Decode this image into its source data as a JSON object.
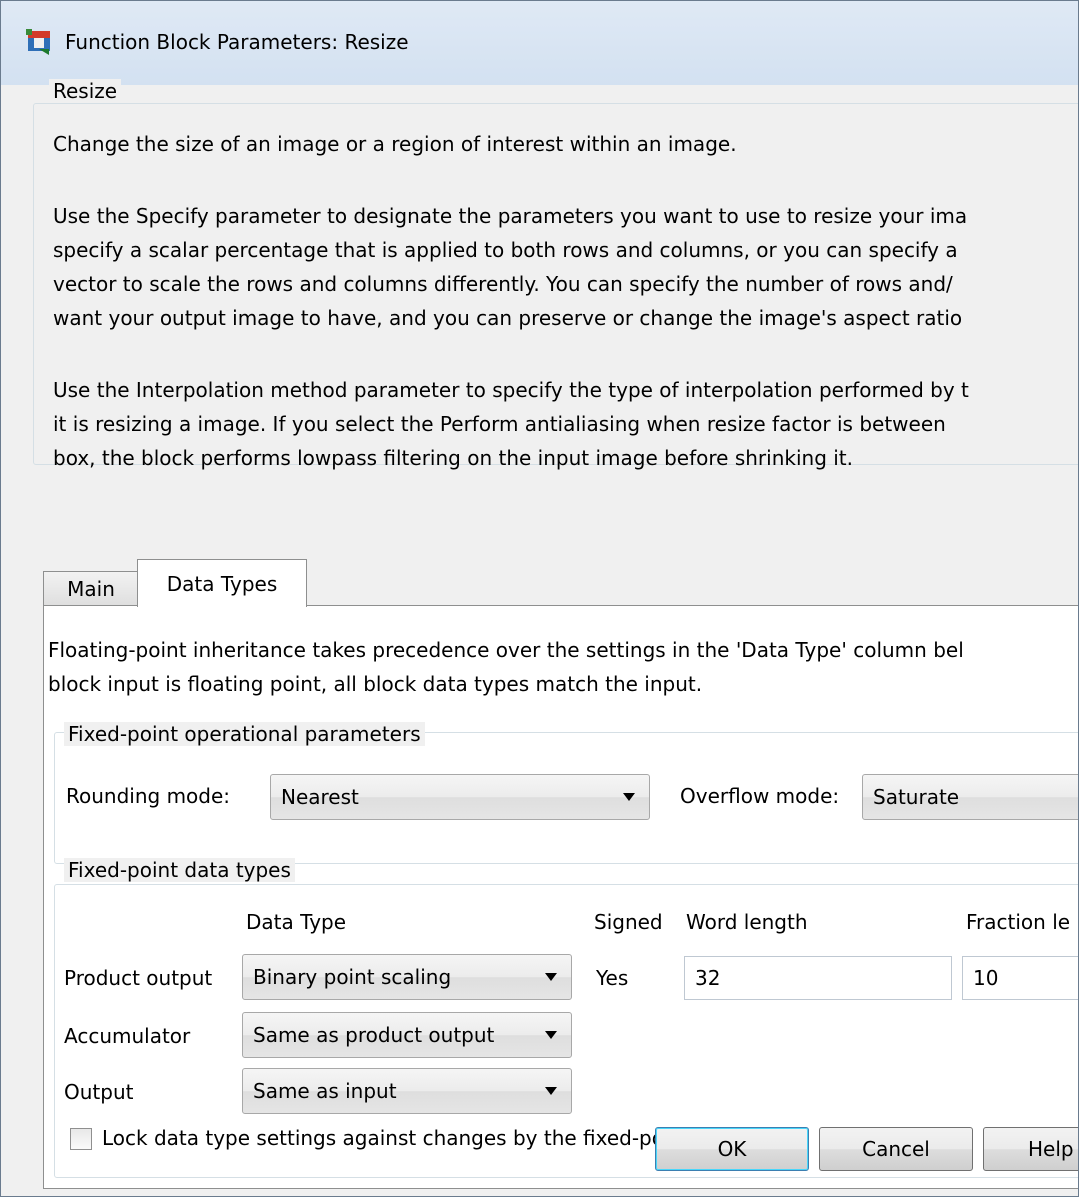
{
  "window": {
    "title": "Function Block Parameters: Resize",
    "icon": "simulink-block-icon"
  },
  "description": {
    "group_label": "Resize",
    "paragraphs": [
      [
        "Change the size of an image or a region of interest within an image."
      ],
      [
        "Use the Specify parameter to designate the parameters you want to use to resize your ima",
        "specify a scalar percentage that is applied to both rows and columns, or you can specify a",
        "vector to scale the rows and columns differently. You can specify the number of rows and/",
        "want your output image to have, and you can preserve or change the image's aspect ratio"
      ],
      [
        "Use the Interpolation method parameter to specify the type of interpolation performed by t",
        "it is resizing a image. If you select the Perform antialiasing when resize factor is between",
        "box, the block performs lowpass filtering on the input image before shrinking it."
      ]
    ]
  },
  "tabs": [
    {
      "label": "Main",
      "active": false
    },
    {
      "label": "Data Types",
      "active": true
    }
  ],
  "data_types_tab": {
    "intro": [
      "Floating-point inheritance takes precedence over the settings in the 'Data Type' column bel",
      "block input is floating point, all block data types match the input."
    ],
    "operational": {
      "group_label": "Fixed-point operational parameters",
      "rounding_label": "Rounding mode:",
      "rounding_value": "Nearest",
      "overflow_label": "Overflow mode:",
      "overflow_value": "Saturate"
    },
    "datatypes": {
      "group_label": "Fixed-point data types",
      "headers": {
        "data_type": "Data Type",
        "signed": "Signed",
        "word_length": "Word length",
        "fraction_length": "Fraction le"
      },
      "rows": [
        {
          "label": "Product output",
          "data_type": "Binary point scaling",
          "signed": "Yes",
          "word_length": "32",
          "fraction_length": "10"
        },
        {
          "label": "Accumulator",
          "data_type": "Same as product output"
        },
        {
          "label": "Output",
          "data_type": "Same as input"
        }
      ],
      "lock_label": "Lock data type settings against changes by the fixed-point tools",
      "lock_checked": false
    }
  },
  "buttons": {
    "ok": "OK",
    "cancel": "Cancel",
    "help": "Help"
  }
}
